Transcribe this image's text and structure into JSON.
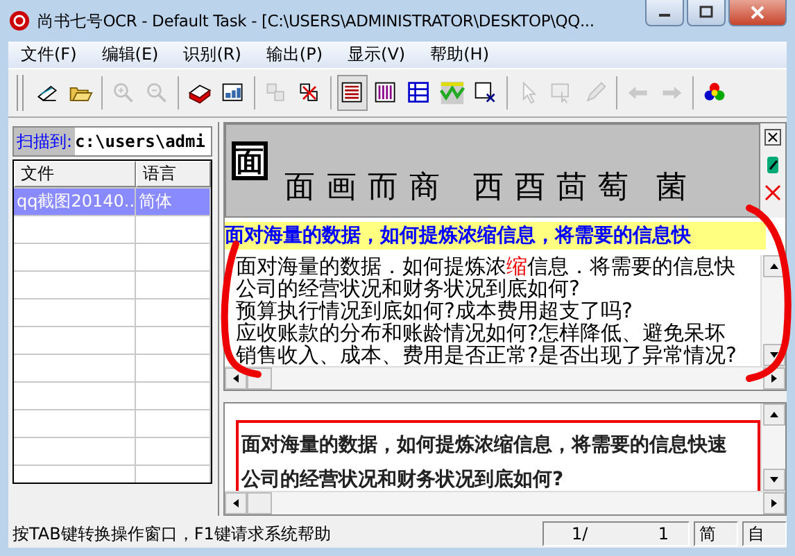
{
  "window": {
    "title": "尚书七号OCR - Default Task - [C:\\USERS\\ADMINISTRATOR\\DESKTOP\\QQ..."
  },
  "menu": [
    "文件(F)",
    "编辑(E)",
    "识别(R)",
    "输出(P)",
    "显示(V)",
    "帮助(H)"
  ],
  "toolbar": [
    [
      {
        "kind": "scan",
        "disabled": false,
        "selected": false
      },
      {
        "kind": "open",
        "disabled": false,
        "selected": false
      }
    ],
    [
      {
        "kind": "zoom-in",
        "disabled": true,
        "selected": false
      },
      {
        "kind": "zoom-out",
        "disabled": true,
        "selected": false
      }
    ],
    [
      {
        "kind": "recognize",
        "disabled": false,
        "selected": false
      },
      {
        "kind": "layout",
        "disabled": false,
        "selected": false
      }
    ],
    [
      {
        "kind": "split",
        "disabled": true,
        "selected": false
      },
      {
        "kind": "merge",
        "disabled": false,
        "selected": false
      }
    ],
    [
      {
        "kind": "text-rows",
        "disabled": false,
        "selected": true
      },
      {
        "kind": "text-columns",
        "disabled": false,
        "selected": false
      },
      {
        "kind": "table",
        "disabled": false,
        "selected": false
      },
      {
        "kind": "image-area",
        "disabled": false,
        "selected": false
      },
      {
        "kind": "delete-area",
        "disabled": false,
        "selected": false
      }
    ],
    [
      {
        "kind": "pointer",
        "disabled": true,
        "selected": false
      },
      {
        "kind": "select",
        "disabled": true,
        "selected": false
      },
      {
        "kind": "pen",
        "disabled": true,
        "selected": false
      }
    ],
    [
      {
        "kind": "back",
        "disabled": true,
        "selected": false
      },
      {
        "kind": "forward",
        "disabled": true,
        "selected": false
      }
    ],
    [
      {
        "kind": "colors",
        "disabled": false,
        "selected": false
      }
    ]
  ],
  "scan_to": {
    "label": "扫描到:",
    "value": "c:\\users\\admi"
  },
  "file_table": {
    "columns": [
      "文件",
      "语言"
    ],
    "rows": [
      {
        "cells": [
          "qq截图20140...",
          "简体"
        ],
        "selected": true
      }
    ]
  },
  "candidates": {
    "glyph": "面",
    "options": [
      "面",
      "画",
      "而",
      "商",
      "西",
      "酉",
      "茴",
      "萄",
      "菌"
    ]
  },
  "current_line": "面对海量的数据，如何提炼浓缩信息，将需要的信息快",
  "editor_lines": [
    [
      {
        "text": "面对海量的数据．如何提炼浓",
        "highlight": false
      },
      {
        "text": "缩",
        "highlight": true
      },
      {
        "text": "信息．将需要的信息快",
        "highlight": false
      }
    ],
    [
      {
        "text": "公司的经营状况和财务状况到底如何?",
        "highlight": false
      }
    ],
    [
      {
        "text": "预算执行情况到底如何?成本费用超支了吗?",
        "highlight": false
      }
    ],
    [
      {
        "text": "应收账款的分布和账龄情况如何?怎样降低、避免呆坏",
        "highlight": false
      }
    ],
    [
      {
        "text": "销售收入、成本、费用是否正常?是否出现了异常情况?",
        "highlight": false
      }
    ]
  ],
  "scan_lines": [
    "面对海量的数据，如何提炼浓缩信息，将需要的信息快速",
    "公司的经营状况和财务状况到底如何?"
  ],
  "status_bar": {
    "message": "按TAB键转换操作窗口，F1键请求系统帮助",
    "page_current": "1/",
    "page_total": "1",
    "language": "简",
    "mode": "自"
  }
}
